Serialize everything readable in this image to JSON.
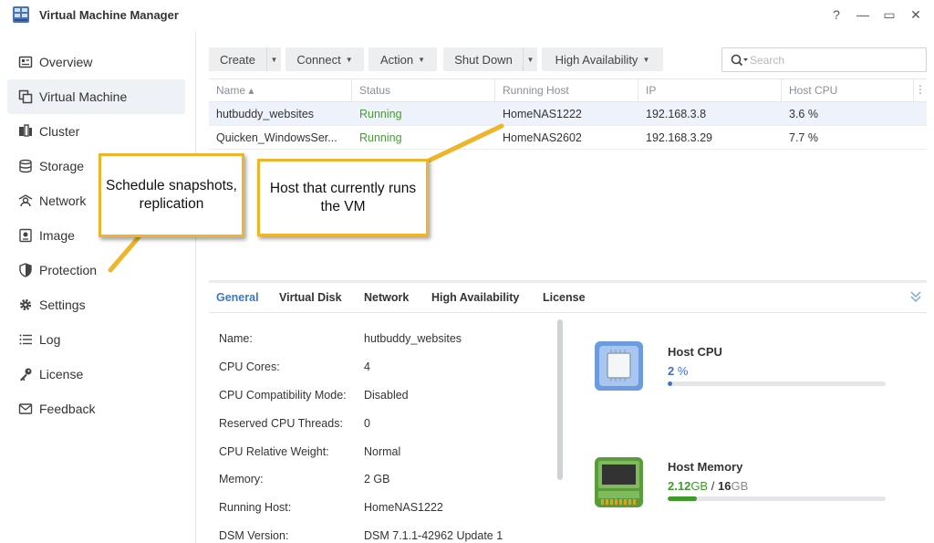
{
  "app": {
    "title": "Virtual Machine Manager"
  },
  "window_controls": {
    "help": "?",
    "minimize": "—",
    "maximize": "▭",
    "close": "✕"
  },
  "sidebar": {
    "items": [
      {
        "label": "Overview",
        "icon": "overview-icon",
        "active": false
      },
      {
        "label": "Virtual Machine",
        "icon": "virtual-machine-icon",
        "active": true
      },
      {
        "label": "Cluster",
        "icon": "cluster-icon",
        "active": false
      },
      {
        "label": "Storage",
        "icon": "storage-icon",
        "active": false
      },
      {
        "label": "Network",
        "icon": "network-icon",
        "active": false
      },
      {
        "label": "Image",
        "icon": "image-icon",
        "active": false
      },
      {
        "label": "Protection",
        "icon": "shield-icon",
        "active": false
      },
      {
        "label": "Settings",
        "icon": "gear-icon",
        "active": false
      },
      {
        "label": "Log",
        "icon": "list-icon",
        "active": false
      },
      {
        "label": "License",
        "icon": "key-icon",
        "active": false
      },
      {
        "label": "Feedback",
        "icon": "mail-icon",
        "active": false
      }
    ]
  },
  "toolbar": {
    "create": "Create",
    "connect": "Connect",
    "action": "Action",
    "shutdown": "Shut Down",
    "high_availability": "High Availability"
  },
  "search": {
    "placeholder": "Search",
    "value": ""
  },
  "grid": {
    "columns": [
      "Name ▴",
      "Status",
      "Running Host",
      "IP",
      "Host CPU"
    ],
    "rows": [
      {
        "name": "hutbuddy_websites",
        "status": "Running",
        "host": "HomeNAS1222",
        "ip": "192.168.3.8",
        "cpu": "3.6 %",
        "selected": true
      },
      {
        "name": "Quicken_WindowsSer...",
        "status": "Running",
        "host": "HomeNAS2602",
        "ip": "192.168.3.29",
        "cpu": "7.7 %",
        "selected": false
      }
    ]
  },
  "callouts": {
    "protection": "Schedule snapshots, replication",
    "host": "Host that currently runs the VM"
  },
  "detail": {
    "tabs": [
      "General",
      "Virtual Disk",
      "Network",
      "High Availability",
      "License"
    ],
    "active_tab": "General",
    "properties": [
      {
        "label": "Name:",
        "value": "hutbuddy_websites"
      },
      {
        "label": "CPU Cores:",
        "value": "4"
      },
      {
        "label": "CPU Compatibility Mode:",
        "value": "Disabled"
      },
      {
        "label": "Reserved CPU Threads:",
        "value": "0"
      },
      {
        "label": "CPU Relative Weight:",
        "value": "Normal"
      },
      {
        "label": "Memory:",
        "value": "2 GB"
      },
      {
        "label": "Running Host:",
        "value": "HomeNAS1222"
      },
      {
        "label": "DSM Version:",
        "value": "DSM 7.1.1-42962 Update 1"
      }
    ],
    "host_cpu": {
      "title": "Host CPU",
      "value": "2",
      "unit": "%",
      "fraction": 0.02,
      "color": "#3b6fd1"
    },
    "host_memory": {
      "title": "Host Memory",
      "used": "2.12",
      "used_unit": "GB",
      "separator": "/",
      "total": "16",
      "total_unit": "GB",
      "fraction": 0.1325,
      "color": "#3f9a2a"
    }
  },
  "colors": {
    "accent": "#3b78c8",
    "running": "#4a9a38",
    "callout_border": "#f0b429"
  }
}
